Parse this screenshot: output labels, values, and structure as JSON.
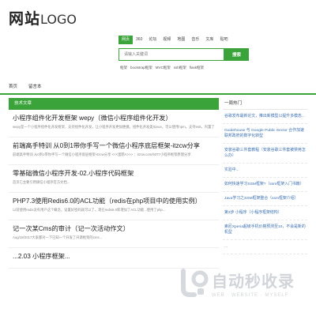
{
  "logo": {
    "cn": "网站",
    "en": "LOGO"
  },
  "search_tabs": [
    "网页",
    "360",
    "论坛",
    "视频",
    "地图",
    "音乐",
    "文库",
    "贴吧"
  ],
  "search": {
    "placeholder": "请输入关键词",
    "button": "搜索"
  },
  "hot_tags": [
    "框架",
    "bootstrap框架",
    "MVC框架",
    "ssh框架",
    "flask框架"
  ],
  "nav": [
    "首页",
    "留言本"
  ],
  "section_title": "技术文章",
  "articles": [
    {
      "title": "小程序组件化开发框架 wepy（微信小程序组件化开发）",
      "excerpt": "wepy是一个小程序组件化开发框架，支持组件化开发，让小程序开发更加便捷。组件化开发类似vue，可以使用npm，支持es6，内置了常用函数...\"<bindtap>\"myclick..."
    },
    {
      "title": "前端高手特训 从0到1带你手写一个微信小程序底层框架-itzcw分享",
      "excerpt": "前端高手特训 从0到1带你手写一个微信小程序底层框架-itzcw分享 <<<蛋糕A>>> ：itzcw.com/9377小程序框架原理分享"
    },
    {
      "title": "零基础微信小程序开发-02.小程序代码框架",
      "excerpt": "首页它主要引用微信小程序官方文档..."
    },
    {
      "title": "PHP7.3使用Redis6.0的ACL功能（redis在php项目中的使用实例）",
      "excerpt": "以前使用redis没有用户这个概念，设置好密码就可以了。现在redis6.0新增加了ACL功能...使用了php..."
    },
    {
      "title": "记一次某Cms的审计（记一次活动作文）",
      "excerpt": "Aug/18/2017大家都对一下已知一个开发了开源框架的cms..."
    },
    {
      "title": "...2.03 小程序框架...",
      "excerpt": ""
    }
  ],
  "sidebar": {
    "title": "一周热门",
    "items": [
      "谷歌发布最新论文，推出新模型以提升多模态...",
      "Guidehouse 与 Google Public Sector 合作加速 联邦政府的数字化转型",
      "安装谷歌三件套教程（安装谷歌三件套被禁用怎么办）",
      "实验中...",
      "如何快速学习SSM框架?（ssm框架入门书籍）",
      "Java学习之SSM框架整合（ssm框架介绍）",
      "第3步 小程序（小程序框架结构）",
      "索尼Xperia超级手机价格预测至10，不会是新的机型",
      "..."
    ]
  },
  "watermark": {
    "title": "自动秒收录",
    "sub": "WEB · WEBSITE · MYSELF"
  }
}
